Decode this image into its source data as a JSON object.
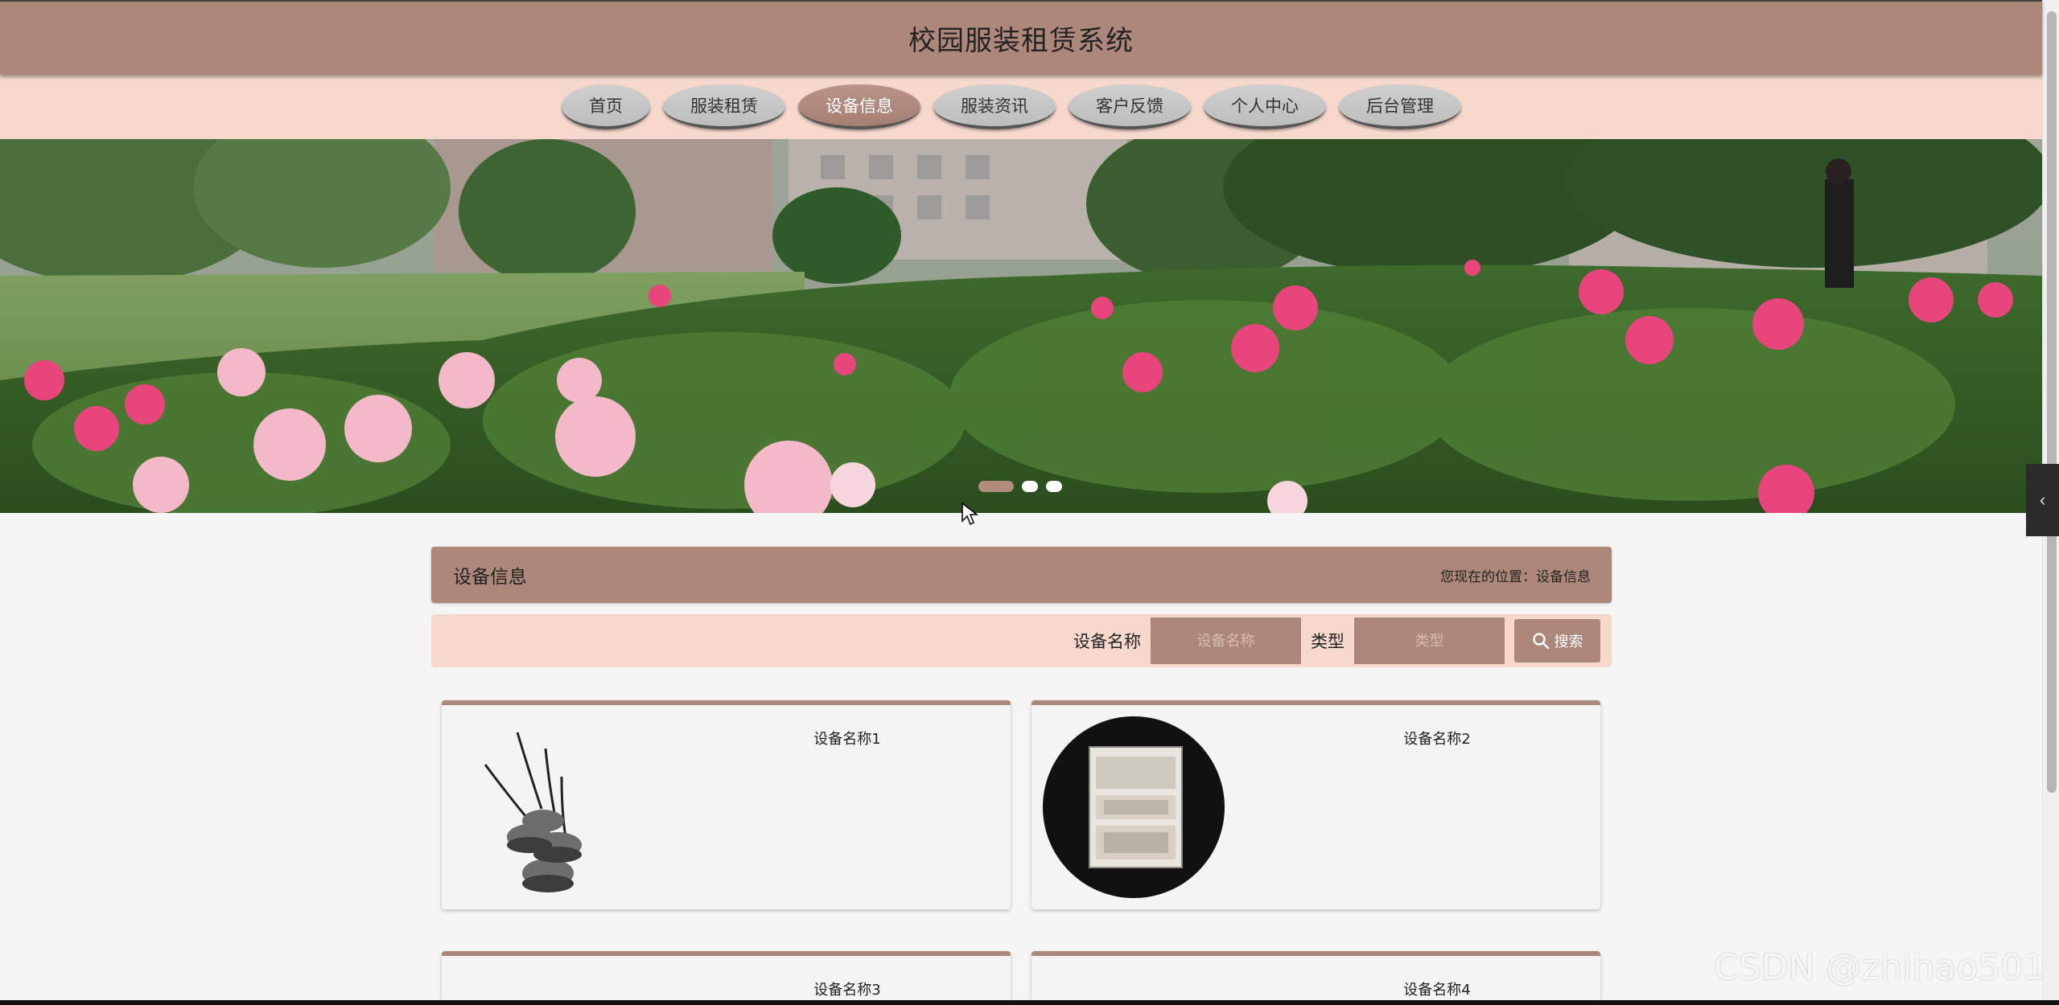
{
  "header": {
    "title": "校园服装租赁系统"
  },
  "nav": {
    "items": [
      {
        "label": "首页"
      },
      {
        "label": "服装租赁"
      },
      {
        "label": "设备信息"
      },
      {
        "label": "服装资讯"
      },
      {
        "label": "客户反馈"
      },
      {
        "label": "个人中心"
      },
      {
        "label": "后台管理"
      }
    ],
    "active_index": 2
  },
  "section": {
    "title": "设备信息",
    "breadcrumb": "您现在的位置：设备信息"
  },
  "search": {
    "name_label": "设备名称",
    "name_placeholder": "设备名称",
    "type_label": "类型",
    "type_placeholder": "类型",
    "button_label": "搜索"
  },
  "cards": [
    {
      "name": "设备名称1"
    },
    {
      "name": "设备名称2"
    },
    {
      "name": "设备名称3"
    },
    {
      "name": "设备名称4"
    }
  ],
  "watermark": "CSDN @zhihao501",
  "colors": {
    "primary": "#ad877a",
    "light": "#f6d8cc"
  }
}
